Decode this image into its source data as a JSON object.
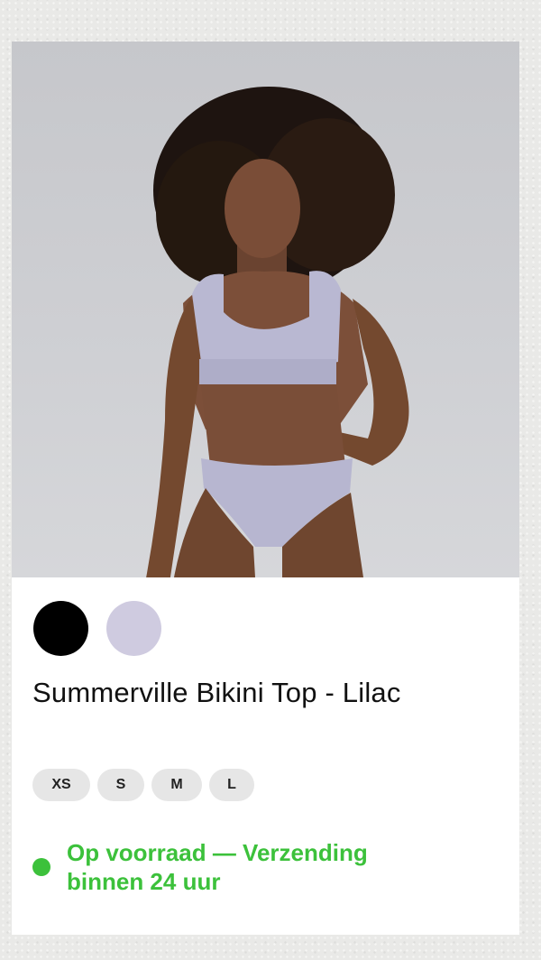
{
  "product": {
    "title": "Summerville Bikini Top - Lilac",
    "image_alt": "Model wearing lilac bikini top and bottom",
    "swatches": [
      {
        "name": "Black",
        "color": "#000000"
      },
      {
        "name": "Lilac",
        "color": "#cfcbe0"
      }
    ],
    "sizes": [
      "XS",
      "S",
      "M",
      "L"
    ],
    "stock": {
      "text": "Op voorraad — Verzending binnen 24 uur",
      "color": "#3cc13b"
    }
  }
}
